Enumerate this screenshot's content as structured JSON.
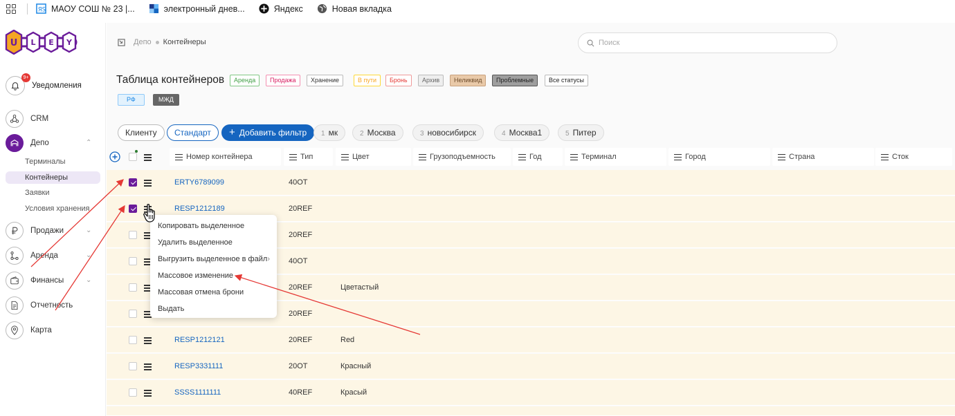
{
  "bookmarks": {
    "items": [
      {
        "label": "МАОУ СОШ № 23 |...",
        "icon": "school-icon"
      },
      {
        "label": "электронный днев...",
        "icon": "diary-icon"
      },
      {
        "label": "Яндекс",
        "icon": "yandex-icon"
      },
      {
        "label": "Новая вкладка",
        "icon": "globe-icon"
      }
    ]
  },
  "logo": {
    "letters": [
      "U",
      "L",
      "E",
      "Y"
    ],
    "brand_color": "#6a1b9a",
    "accent_color": "#f5a623"
  },
  "sidebar": {
    "notifications": {
      "label": "Уведомления",
      "badge": "9+"
    },
    "items": [
      {
        "label": "CRM",
        "icon": "crm-icon"
      },
      {
        "label": "Депо",
        "icon": "depot-icon"
      },
      {
        "label": "Продажи",
        "icon": "ruble-icon"
      },
      {
        "label": "Аренда",
        "icon": "rent-icon"
      },
      {
        "label": "Финансы",
        "icon": "wallet-icon"
      },
      {
        "label": "Отчетность",
        "icon": "report-icon"
      },
      {
        "label": "Карта",
        "icon": "map-pin-icon"
      }
    ],
    "depot_sub": [
      "Терминалы",
      "Контейнеры",
      "Заявки",
      "Условия хранения"
    ]
  },
  "breadcrumb": {
    "parent": "Депо",
    "current": "Контейнеры"
  },
  "search": {
    "placeholder": "Поиск"
  },
  "page": {
    "title": "Таблица контейнеров"
  },
  "status_tags": [
    {
      "label": "Аренда",
      "color": "#43a047"
    },
    {
      "label": "Продажа",
      "color": "#e91e63"
    },
    {
      "label": "Хранение",
      "color": "#555555"
    },
    {
      "label": "В пути",
      "color": "#f9a825"
    },
    {
      "label": "Бронь",
      "color": "#e53935"
    },
    {
      "label": "Архив",
      "color": "#777777"
    },
    {
      "label": "Неликвид",
      "color": "#8d5a2b"
    },
    {
      "label": "Проблемные",
      "color": "#333333"
    },
    {
      "label": "Все статусы",
      "color": "#333333"
    }
  ],
  "region_tags": [
    {
      "label": "РФ"
    },
    {
      "label": "МЖД"
    }
  ],
  "filters": {
    "by_client": "Клиенту",
    "standard": "Стандарт",
    "add_filter": "Добавить фильтр",
    "saved": [
      {
        "num": "1",
        "label": "мк"
      },
      {
        "num": "2",
        "label": "Москва"
      },
      {
        "num": "3",
        "label": "новосибирск"
      },
      {
        "num": "4",
        "label": "Москва1"
      },
      {
        "num": "5",
        "label": "Питер"
      }
    ]
  },
  "table": {
    "columns": [
      "Номер контейнера",
      "Тип",
      "Цвет",
      "Грузоподъемность",
      "Год",
      "Терминал",
      "Город",
      "Страна",
      "Сток"
    ],
    "rows": [
      {
        "number": "ERTY6789099",
        "type": "40OT",
        "color": "",
        "checked": true
      },
      {
        "number": "RESP1212189",
        "type": "20REF",
        "color": "",
        "checked": true
      },
      {
        "number": "",
        "type": "20REF",
        "color": "",
        "checked": false
      },
      {
        "number": "",
        "type": "40OT",
        "color": "",
        "checked": false
      },
      {
        "number": "",
        "type": "20REF",
        "color": "Цветастый",
        "checked": false
      },
      {
        "number": "",
        "type": "20REF",
        "color": "",
        "checked": false
      },
      {
        "number": "RESP1212121",
        "type": "20REF",
        "color": "Red",
        "checked": false
      },
      {
        "number": "RESP3331111",
        "type": "20OT",
        "color": "Красный",
        "checked": false
      },
      {
        "number": "SSSS1111111",
        "type": "40REF",
        "color": "Красый",
        "checked": false
      }
    ]
  },
  "context_menu": {
    "items": [
      {
        "label": "Копировать выделенное"
      },
      {
        "label": "Удалить выделенное"
      },
      {
        "label": "Выгрузить выделенное в файл",
        "has_submenu": true
      },
      {
        "label": "Массовое изменение"
      },
      {
        "label": "Массовая отмена брони"
      },
      {
        "label": "Выдать"
      }
    ]
  },
  "annotation": {
    "arrow_color": "#e53935"
  }
}
